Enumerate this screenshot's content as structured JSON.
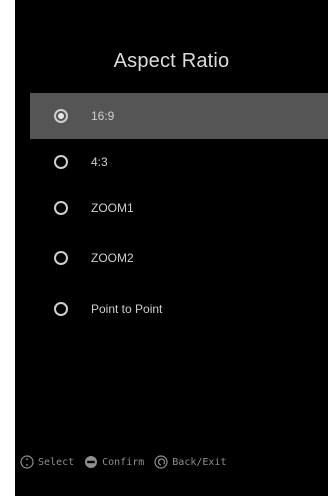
{
  "menu": {
    "title": "Aspect Ratio",
    "options": [
      {
        "label": "16:9",
        "selected": true
      },
      {
        "label": "4:3",
        "selected": false
      },
      {
        "label": "ZOOM1",
        "selected": false
      },
      {
        "label": "ZOOM2",
        "selected": false
      },
      {
        "label": "Point to Point",
        "selected": false
      }
    ]
  },
  "footer": {
    "select_label": "Select",
    "confirm_label": "Confirm",
    "back_label": "Back/Exit",
    "icons": [
      "dpad-icon",
      "enter-icon",
      "back-arrow-icon"
    ]
  },
  "colors": {
    "background": "#000000",
    "highlight": "#555555",
    "text": "#cfcfcf",
    "footer_text": "#8f8f8f"
  }
}
